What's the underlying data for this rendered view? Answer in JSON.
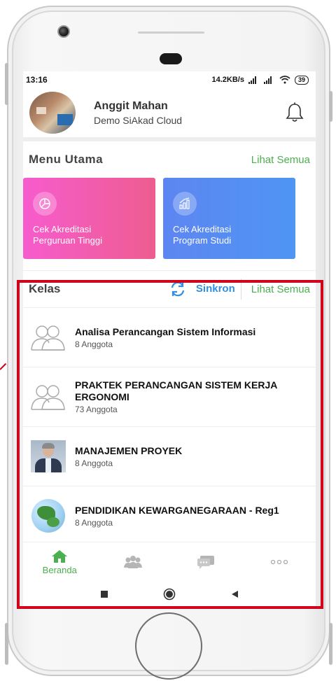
{
  "status_bar": {
    "time": "13:16",
    "network": "14.2KB/s",
    "battery": "39"
  },
  "profile": {
    "name": "Anggit Mahan",
    "subtitle": "Demo SiAkad Cloud"
  },
  "menu": {
    "title": "Menu Utama",
    "see_all": "Lihat Semua",
    "cards": [
      {
        "label_line1": "Cek Akreditasi",
        "label_line2": "Perguruan Tinggi",
        "icon": "pie-chart-icon",
        "color": "#f75bce"
      },
      {
        "label_line1": "Cek Akreditasi",
        "label_line2": "Program Studi",
        "icon": "bar-chart-icon",
        "color": "#5d86f2"
      }
    ]
  },
  "kelas": {
    "title": "Kelas",
    "sync_label": "Sinkron",
    "see_all": "Lihat Semua",
    "items": [
      {
        "name": "Analisa Perancangan Sistem Informasi",
        "count": "8 Anggota",
        "thumb": "group-icon"
      },
      {
        "name_line1": "PRAKTEK PERANCANGAN SISTEM KERJA",
        "name_line2": "ERGONOMI",
        "count": "73 Anggota",
        "thumb": "group-icon"
      },
      {
        "name": "MANAJEMEN PROYEK",
        "count": "8 Anggota",
        "thumb": "person-photo"
      },
      {
        "name": "PENDIDIKAN KEWARGANEGARAAN - Reg1",
        "count": "8 Anggota",
        "thumb": "globe-image"
      }
    ]
  },
  "bottom_nav": {
    "items": [
      {
        "label": "Beranda",
        "icon": "home-icon",
        "active": true
      },
      {
        "icon": "people-icon"
      },
      {
        "icon": "chat-icon"
      },
      {
        "icon": "more-icon"
      }
    ]
  },
  "colors": {
    "accent_green": "#4caf50",
    "sync_blue": "#2f8fe6",
    "highlight_red": "#d0021b"
  }
}
